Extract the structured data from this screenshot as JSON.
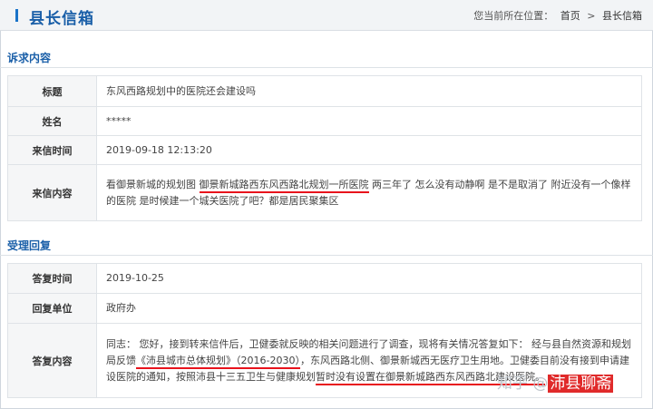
{
  "header": {
    "title": "县长信箱",
    "location_label": "您当前所在位置：",
    "home_link": "首页",
    "separator": ">",
    "current": "县长信箱"
  },
  "request": {
    "section_title": "诉求内容",
    "rows": {
      "title": {
        "label": "标题",
        "value": "东风西路规划中的医院还会建设吗"
      },
      "name": {
        "label": "姓名",
        "value": "*****"
      },
      "time": {
        "label": "来信时间",
        "value": "2019-09-18 12:13:20"
      },
      "content": {
        "label": "来信内容",
        "part1": "看御景新城的规划图 ",
        "highlight": "御景新城路西东风西路北规划一所医院",
        "part2": " 两三年了 怎么没有动静啊 是不是取消了 附近没有一个像样的医院 是时候建一个城关医院了吧？都是居民聚集区"
      }
    }
  },
  "reply": {
    "section_title": "受理回复",
    "rows": {
      "time": {
        "label": "答复时间",
        "value": "2019-10-25"
      },
      "unit": {
        "label": "回复单位",
        "value": "政府办"
      },
      "content": {
        "label": "答复内容",
        "part1": "同志： 您好，接到转来信件后，卫健委就反映的相关问题进行了调查，现将有关情况答复如下： 经与县自然资源和规划局反馈",
        "highlight1": "《沛县城市总体规划》（2016-2030）",
        "part2": "，东风西路北侧、御景新城西无医疗卫生用地。卫健委目前没有接到申请建设医院的通知，按照沛县十三五卫生与健康规划",
        "highlight2": "暂时没有设置在御景新城路西东风西路北建设医院。"
      }
    }
  },
  "watermark": {
    "site": "知乎 @",
    "author": "沛县聊斋"
  }
}
